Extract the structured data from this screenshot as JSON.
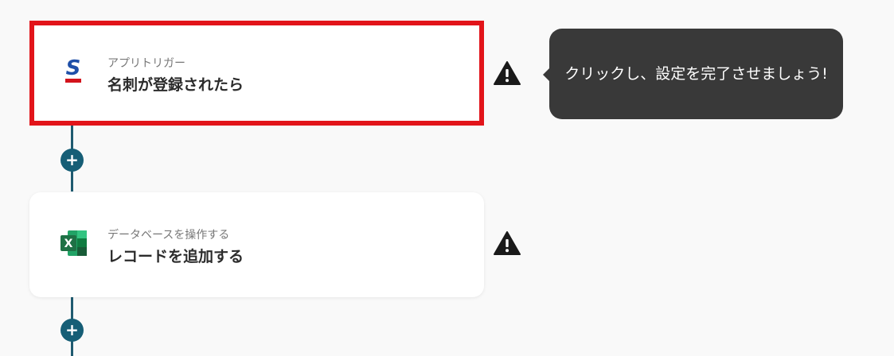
{
  "steps": [
    {
      "app_icon": "sansan-icon",
      "sub_label": "アプリトリガー",
      "main_label": "名刺が登録されたら",
      "warning_icon": "warning-triangle-icon",
      "highlighted": true
    },
    {
      "app_icon": "excel-icon",
      "sub_label": "データベースを操作する",
      "main_label": "レコードを追加する",
      "warning_icon": "warning-triangle-icon",
      "highlighted": false
    }
  ],
  "add_buttons": [
    {
      "icon": "plus-icon",
      "label": "+"
    },
    {
      "icon": "plus-icon",
      "label": "+"
    }
  ],
  "tooltip": {
    "text": "クリックし、設定を完了させましょう!"
  },
  "colors": {
    "background": "#f9f9f9",
    "connector": "#1f5b70",
    "add_button": "#165e76",
    "highlight_border": "#e2141a",
    "tooltip_bg": "#393939",
    "sansan_blue": "#1e4fa8",
    "sansan_red": "#d3141c",
    "excel_green": "#1e7145"
  }
}
